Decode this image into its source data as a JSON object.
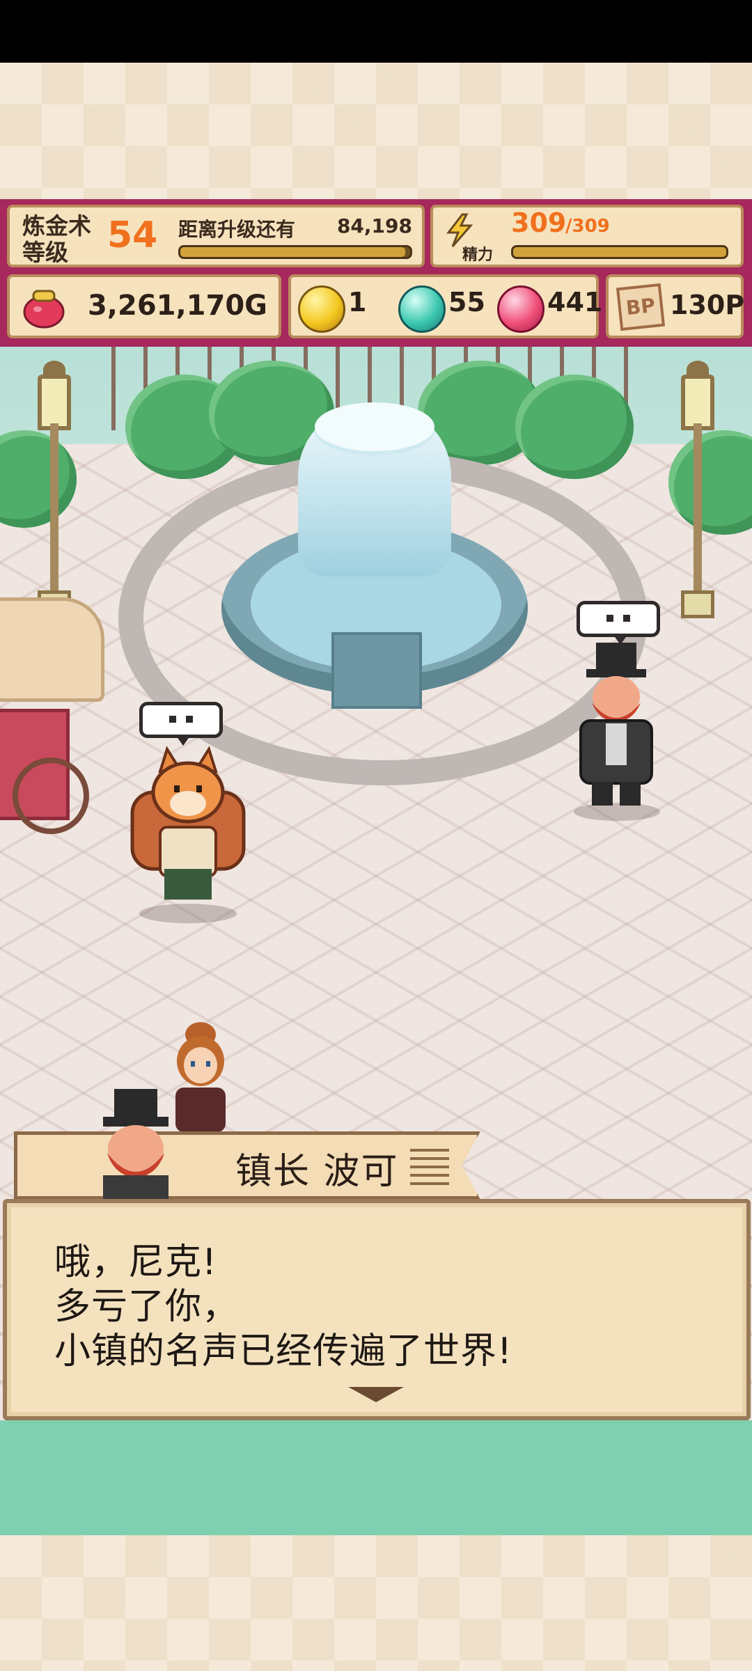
{
  "hud": {
    "level_label_line1": "炼金术",
    "level_label_line2": "等级",
    "level_value": "54",
    "next_level_label": "距离升级还有",
    "next_level_value": "84,198",
    "next_level_progress": 0.98,
    "energy_label": "精力",
    "energy_current": "309",
    "energy_max": "/309",
    "energy_progress": 1.0,
    "gold_value": "3,261,170G",
    "gem_yellow": "1",
    "gem_teal": "55",
    "gem_pink": "441",
    "bp_icon_text": "BP",
    "bp_value": "130P"
  },
  "dialog": {
    "speaker": "镇长 波可",
    "lines": [
      "哦，尼克!",
      "多亏了你，",
      "小镇的名声已经传遍了世界!"
    ]
  },
  "colors": {
    "hud_bg": "#a6285d",
    "accent_orange": "#f0701e",
    "panel_bg": "#f6e3be",
    "dialog_bg": "#f4e2bf"
  }
}
